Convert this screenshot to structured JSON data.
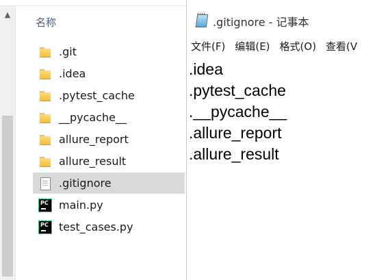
{
  "explorer": {
    "column_header": "名称",
    "files": [
      {
        "name": ".git",
        "icon": "folder-icon",
        "selected": false
      },
      {
        "name": ".idea",
        "icon": "folder-icon",
        "selected": false
      },
      {
        "name": ".pytest_cache",
        "icon": "folder-icon",
        "selected": false
      },
      {
        "name": "__pycache__",
        "icon": "folder-icon",
        "selected": false
      },
      {
        "name": "allure_report",
        "icon": "folder-icon",
        "selected": false
      },
      {
        "name": "allure_result",
        "icon": "folder-icon",
        "selected": false
      },
      {
        "name": ".gitignore",
        "icon": "text-file-icon",
        "selected": true
      },
      {
        "name": "main.py",
        "icon": "pycharm-icon",
        "selected": false
      },
      {
        "name": "test_cases.py",
        "icon": "pycharm-icon",
        "selected": false
      }
    ],
    "pycharm_icon_text": "PC"
  },
  "notepad": {
    "title": ".gitignore - 记事本",
    "menu": [
      "文件(F)",
      "编辑(E)",
      "格式(O)",
      "查看(V"
    ],
    "lines": [
      ".idea",
      ".pytest_cache",
      ".__pycache__",
      ".allure_report",
      ".allure_result"
    ]
  },
  "colors": {
    "selected_row": "#d9d9d9",
    "header_text": "#4d6082",
    "pycharm_border": "#21d789"
  }
}
